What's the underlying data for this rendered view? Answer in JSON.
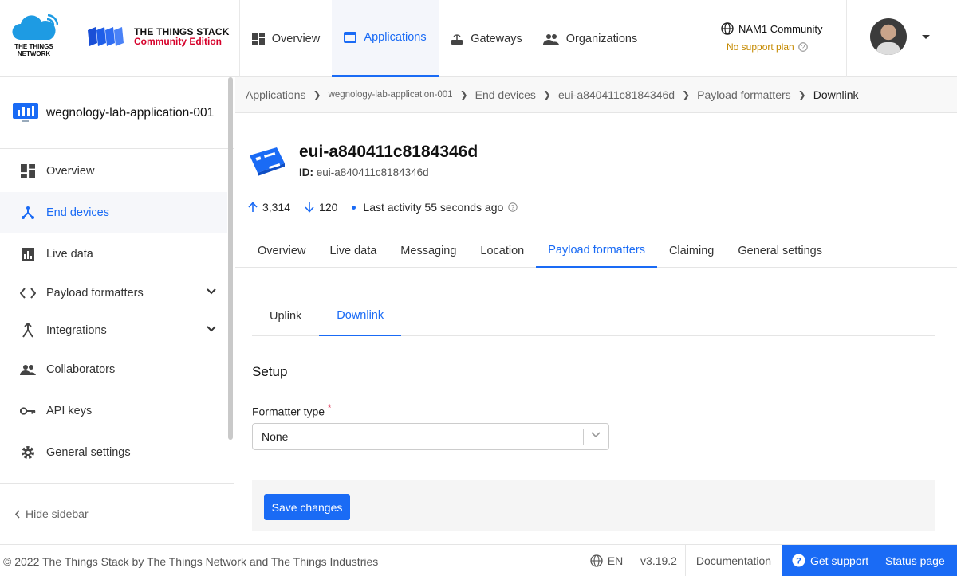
{
  "header": {
    "ttn_logo_line1": "THE THINGS",
    "ttn_logo_line2": "NETWORK",
    "tts_title": "THE THINGS STACK",
    "tts_subtitle": "Community Edition",
    "nav": [
      {
        "label": "Overview",
        "icon": "dashboard-icon"
      },
      {
        "label": "Applications",
        "icon": "application-icon"
      },
      {
        "label": "Gateways",
        "icon": "gateway-icon"
      },
      {
        "label": "Organizations",
        "icon": "people-icon"
      }
    ],
    "cluster_name": "NAM1 Community",
    "support_plan": "No support plan"
  },
  "sidebar": {
    "app_name": "wegnology-lab-application-001",
    "items": [
      {
        "label": "Overview",
        "icon": "dashboard-icon"
      },
      {
        "label": "End devices",
        "icon": "device-tree-icon"
      },
      {
        "label": "Live data",
        "icon": "chart-icon"
      },
      {
        "label": "Payload formatters",
        "icon": "code-icon"
      },
      {
        "label": "Integrations",
        "icon": "merge-icon"
      },
      {
        "label": "Collaborators",
        "icon": "people-icon"
      },
      {
        "label": "API keys",
        "icon": "key-icon"
      },
      {
        "label": "General settings",
        "icon": "gear-icon"
      }
    ],
    "hide_label": "Hide sidebar"
  },
  "breadcrumbs": [
    "Applications",
    "wegnology-lab-application-001",
    "End devices",
    "eui-a840411c8184346d",
    "Payload formatters",
    "Downlink"
  ],
  "device": {
    "title": "eui-a840411c8184346d",
    "id_label": "ID:",
    "id_value": "eui-a840411c8184346d",
    "uplink_count": "3,314",
    "downlink_count": "120",
    "last_activity": "Last activity 55 seconds ago"
  },
  "tabs": [
    "Overview",
    "Live data",
    "Messaging",
    "Location",
    "Payload formatters",
    "Claiming",
    "General settings"
  ],
  "subtabs": [
    "Uplink",
    "Downlink"
  ],
  "form": {
    "section_title": "Setup",
    "formatter_label": "Formatter type",
    "required_mark": "*",
    "formatter_value": "None",
    "save_label": "Save changes"
  },
  "footer": {
    "copyright": "© 2022 The Things Stack by The Things Network and The Things Industries",
    "language": "EN",
    "version": "v3.19.2",
    "documentation": "Documentation",
    "get_support": "Get support",
    "status_page": "Status page"
  },
  "colors": {
    "accent": "#1a6bf5",
    "required": "#d6002a",
    "support_plan": "#c58a00"
  }
}
